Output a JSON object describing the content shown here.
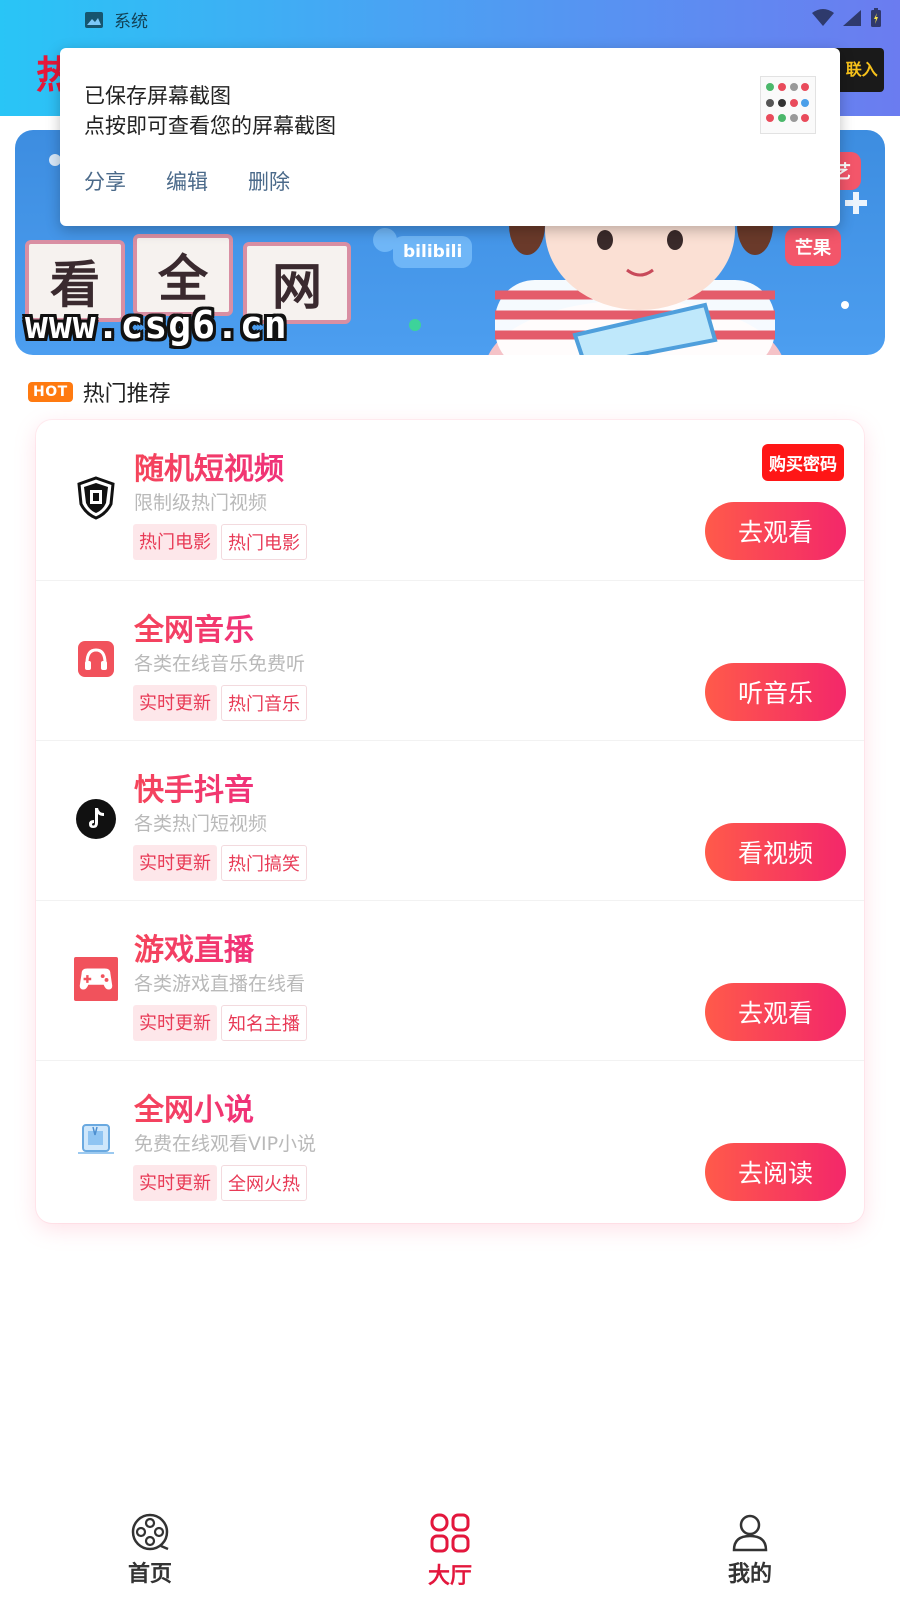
{
  "statusbar": {
    "app_name": "系统",
    "icons": [
      "image-icon",
      "wifi-icon",
      "signal-icon",
      "battery-icon"
    ]
  },
  "header": {
    "title_partial": "热",
    "logo_text": "开 联入"
  },
  "toast": {
    "line1": "已保存屏幕截图",
    "line2": "点按即可查看您的屏幕截图",
    "actions": [
      "分享",
      "编辑",
      "删除"
    ]
  },
  "banner": {
    "url": "www.csg6.cn",
    "tiles": [
      "看",
      "全",
      "网"
    ],
    "badges": [
      "芒果",
      "奇艺",
      "bilibili"
    ]
  },
  "section": {
    "badge": "HOT",
    "title": "热门推荐"
  },
  "items": [
    {
      "title": "随机短视频",
      "desc": "限制级热门视频",
      "tags": [
        "热门电影",
        "热门电影"
      ],
      "button": "去观看",
      "badge": "购买密码",
      "icon": "restricted-shield-icon"
    },
    {
      "title": "全网音乐",
      "desc": "各类在线音乐免费听",
      "tags": [
        "实时更新",
        "热门音乐"
      ],
      "button": "听音乐",
      "icon": "headphones-icon"
    },
    {
      "title": "快手抖音",
      "desc": "各类热门短视频",
      "tags": [
        "实时更新",
        "热门搞笑"
      ],
      "button": "看视频",
      "icon": "tiktok-icon"
    },
    {
      "title": "游戏直播",
      "desc": "各类游戏直播在线看",
      "tags": [
        "实时更新",
        "知名主播"
      ],
      "button": "去观看",
      "icon": "gamepad-icon"
    },
    {
      "title": "全网小说",
      "desc": "免费在线观看VIP小说",
      "tags": [
        "实时更新",
        "全网火热"
      ],
      "button": "去阅读",
      "icon": "book-icon"
    }
  ],
  "nav": {
    "items": [
      {
        "label": "首页",
        "icon": "film-reel-icon"
      },
      {
        "label": "大厅",
        "icon": "grid-icon"
      },
      {
        "label": "我的",
        "icon": "user-icon"
      }
    ],
    "active": "大厅"
  },
  "colors": {
    "accent": "#e3173d",
    "button_gradient_start": "#ff5a4a",
    "button_gradient_end": "#f3276a",
    "hot_badge": "#ff7a10"
  }
}
